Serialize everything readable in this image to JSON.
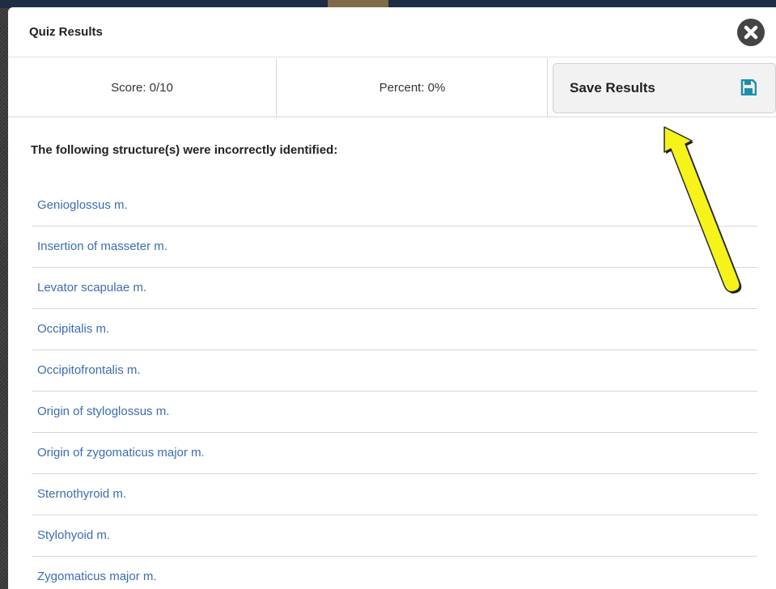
{
  "modal": {
    "title": "Quiz Results",
    "close_icon": "close-icon"
  },
  "scores": {
    "score_text": "Score: 0/10",
    "percent_text": "Percent: 0%"
  },
  "save_button": {
    "label": "Save Results",
    "icon": "floppy-disk-icon",
    "icon_color": "#1f8fa8"
  },
  "results": {
    "heading": "The following structure(s) were incorrectly identified:",
    "items": [
      "Genioglossus m.",
      "Insertion of masseter m.",
      "Levator scapulae m.",
      "Occipitalis m.",
      "Occipitofrontalis m.",
      "Origin of styloglossus m.",
      "Origin of zygomaticus major m.",
      "Sternothyroid m.",
      "Stylohyoid m.",
      "Zygomaticus major m."
    ]
  },
  "annotation": {
    "arrow_color": "#f5f31a",
    "arrow_icon": "yellow-arrow-annotation"
  },
  "colors": {
    "link": "#3b6db1",
    "close_button": "#444444"
  }
}
